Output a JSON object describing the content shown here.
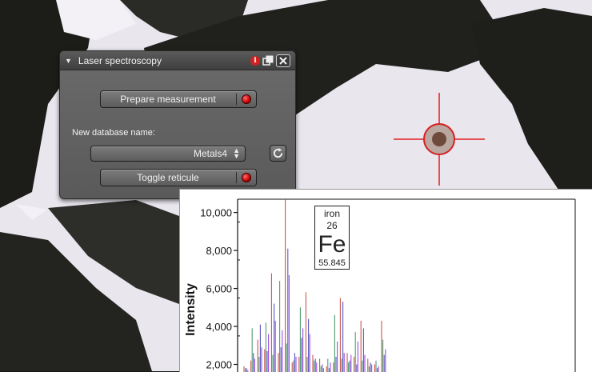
{
  "panel": {
    "title": "Laser spectroscopy",
    "prepare_label": "Prepare measurement",
    "db_label": "New database name:",
    "db_value": "Metals4",
    "toggle_label": "Toggle reticule",
    "colors": {
      "led": "#d40000",
      "panel_bg": "#5f5f5f"
    },
    "icons": [
      "collapse-triangle-icon",
      "info-icon",
      "float-window-icon",
      "close-icon",
      "refresh-icon"
    ]
  },
  "element": {
    "name": "iron",
    "number": "26",
    "symbol": "Fe",
    "mass": "55.845"
  },
  "chart_data": {
    "type": "line",
    "ylabel": "Intensity",
    "y_ticks": [
      "2,000",
      "4,000",
      "6,000",
      "8,000",
      "10,000"
    ],
    "y_tick_values": [
      2000,
      4000,
      6000,
      8000,
      10000
    ],
    "ylim": [
      1600,
      10700
    ],
    "grid": false,
    "series_colors": [
      "#c0392b",
      "#2e8b57",
      "#3b3bb3",
      "#8a2be2"
    ],
    "series": [
      {
        "values": [
          1900,
          2200,
          3300,
          2800,
          6800,
          2600,
          10700,
          2100,
          2400,
          5800,
          2500,
          2300,
          1900,
          2100,
          5500,
          2600,
          2400,
          4300,
          2300,
          2000,
          4300
        ]
      },
      {
        "values": [
          1800,
          3900,
          2400,
          4200,
          2500,
          6400,
          3100,
          2200,
          5000,
          2400,
          2200,
          1900,
          2300,
          4600,
          2300,
          2100,
          3700,
          2200,
          1900,
          2200,
          3300
        ]
      },
      {
        "values": [
          1800,
          2600,
          4100,
          2700,
          5200,
          2900,
          8100,
          2600,
          3400,
          4400,
          2300,
          2000,
          1800,
          2400,
          5300,
          2200,
          2000,
          3900,
          2100,
          1800,
          2500
        ]
      },
      {
        "values": [
          1700,
          2300,
          2900,
          3600,
          4300,
          3800,
          6700,
          2400,
          3900,
          3600,
          2100,
          1800,
          2100,
          3200,
          2600,
          2500,
          3200,
          2500,
          2000,
          1900,
          2800
        ]
      }
    ]
  }
}
